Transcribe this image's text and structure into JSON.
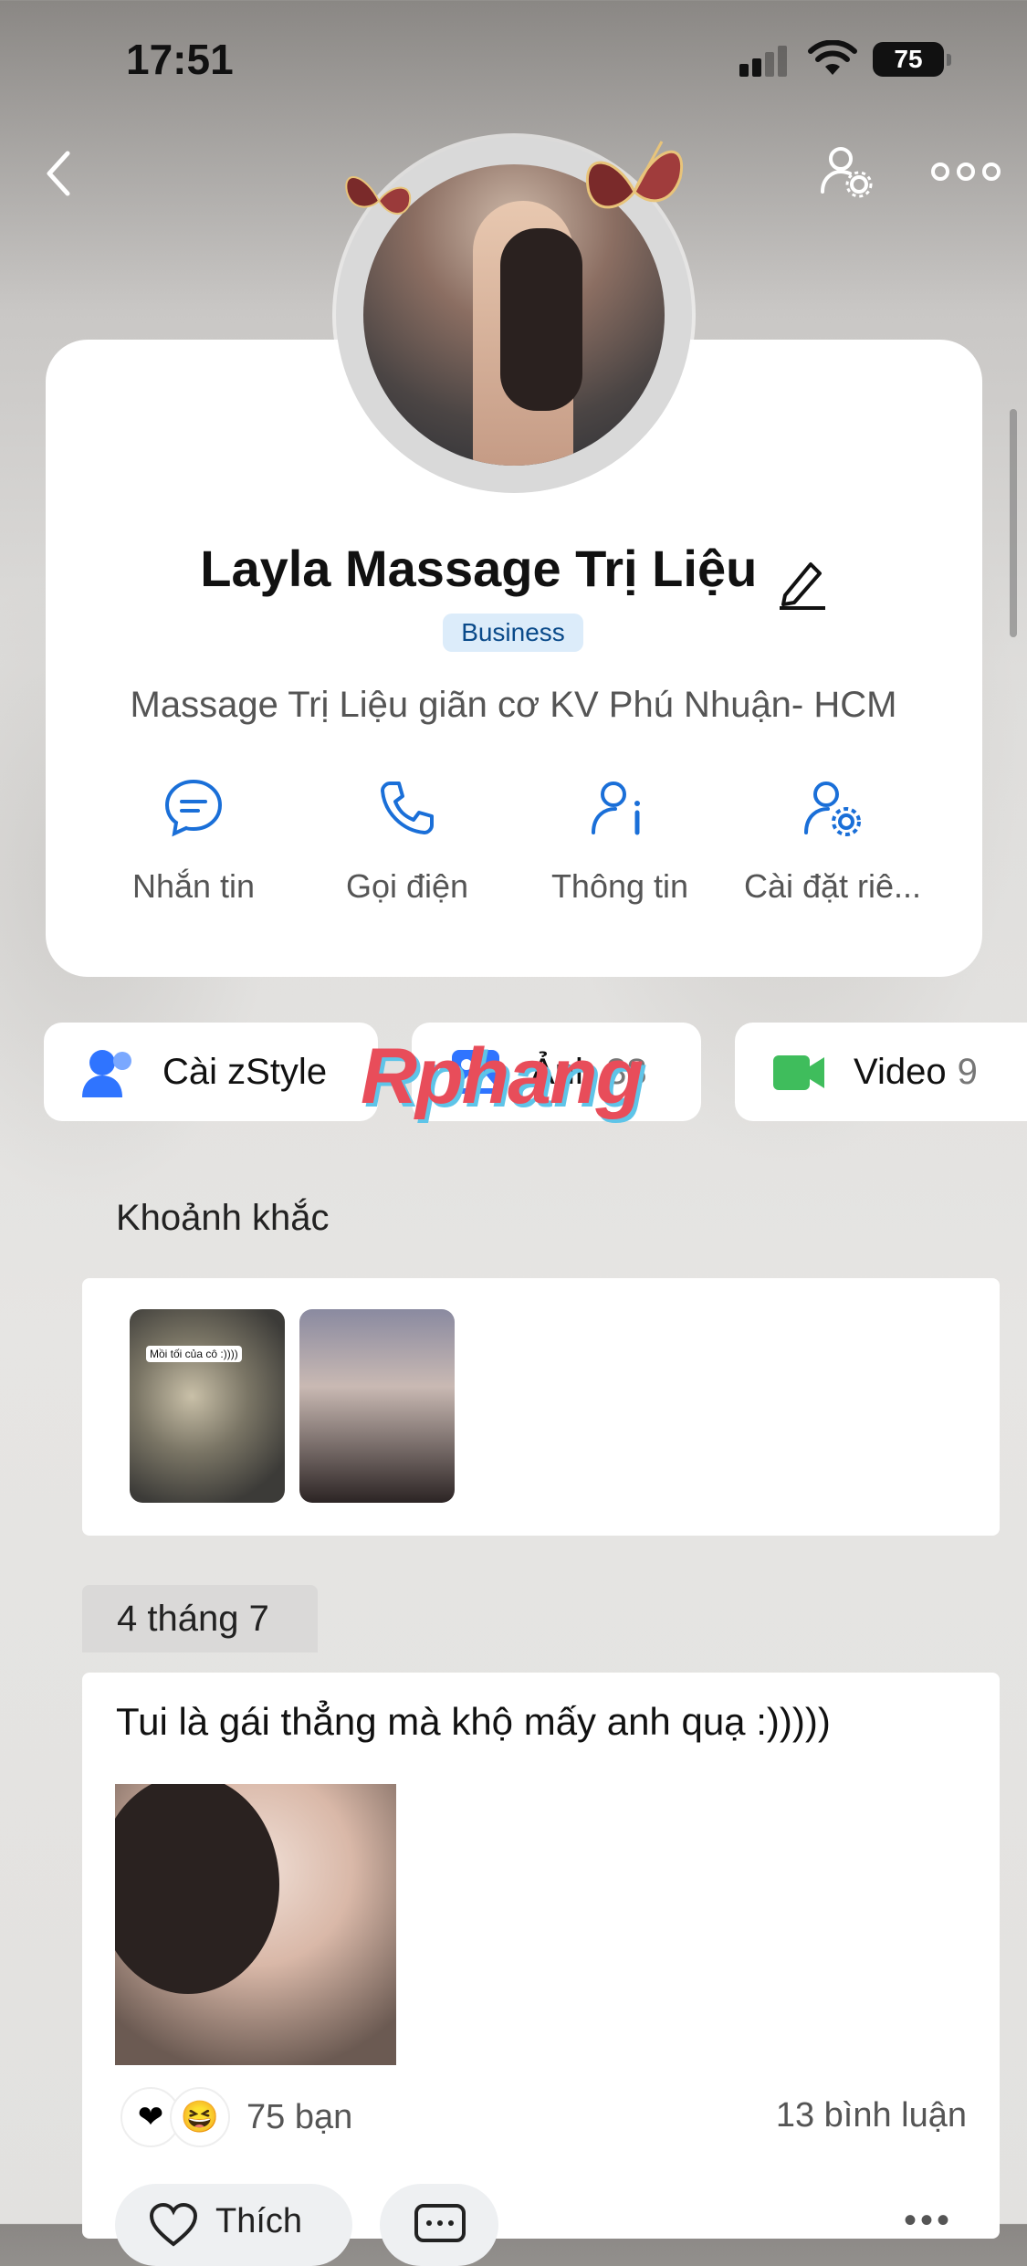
{
  "status_bar": {
    "time": "17:51",
    "battery": "75"
  },
  "profile": {
    "name": "Layla Massage Trị Liệu",
    "badge": "Business",
    "bio": "Massage Trị Liệu giãn cơ KV Phú Nhuận- HCM"
  },
  "actions": [
    {
      "label": "Nhắn tin",
      "icon": "chat-icon"
    },
    {
      "label": "Gọi điện",
      "icon": "phone-icon"
    },
    {
      "label": "Thông tin",
      "icon": "user-info-icon"
    },
    {
      "label": "Cài đặt riê...",
      "icon": "user-settings-icon"
    }
  ],
  "chips": {
    "zstyle": {
      "label": "Cài zStyle"
    },
    "photos": {
      "label": "Ảnh",
      "count": "38"
    },
    "videos": {
      "label": "Video",
      "count": "9"
    }
  },
  "watermark": "Rphang",
  "moments": {
    "title": "Khoảnh khắc",
    "thumb1_caption": "Mồi tối của cô :))))"
  },
  "feed": {
    "date": "4 tháng 7",
    "post": {
      "text": "Tui là gái thẳng mà khộ mấy anh quạ :)))))",
      "likes": "75 bạn",
      "comments": "13 bình luận",
      "like_label": "Thích"
    }
  },
  "colors": {
    "accent": "#1a6fd8",
    "badge_bg": "#dcecfa",
    "video_green": "#3fbd5c",
    "zstyle_blue": "#2f74ff"
  }
}
